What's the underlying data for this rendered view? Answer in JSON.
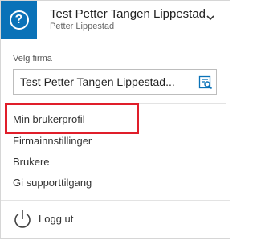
{
  "header": {
    "help_icon": "help-circle-icon",
    "help_glyph": "?",
    "company_name": "Test Petter Tangen Lippestad",
    "user_name": "Petter Lippestad",
    "chevron_icon": "chevron-down-icon"
  },
  "company_select": {
    "label": "Velg firma",
    "value": "Test Petter Tangen Lippestad...",
    "icon": "search-list-icon"
  },
  "menu": {
    "items": [
      {
        "label": "Min brukerprofil",
        "highlighted": true
      },
      {
        "label": "Firmainnstillinger"
      },
      {
        "label": "Brukere"
      },
      {
        "label": "Gi supporttilgang"
      }
    ]
  },
  "footer": {
    "logout_icon": "power-icon",
    "logout_label": "Logg ut"
  },
  "colors": {
    "accent": "#0a72b8",
    "highlight": "#e01e2a",
    "border": "#d6d6d6"
  }
}
